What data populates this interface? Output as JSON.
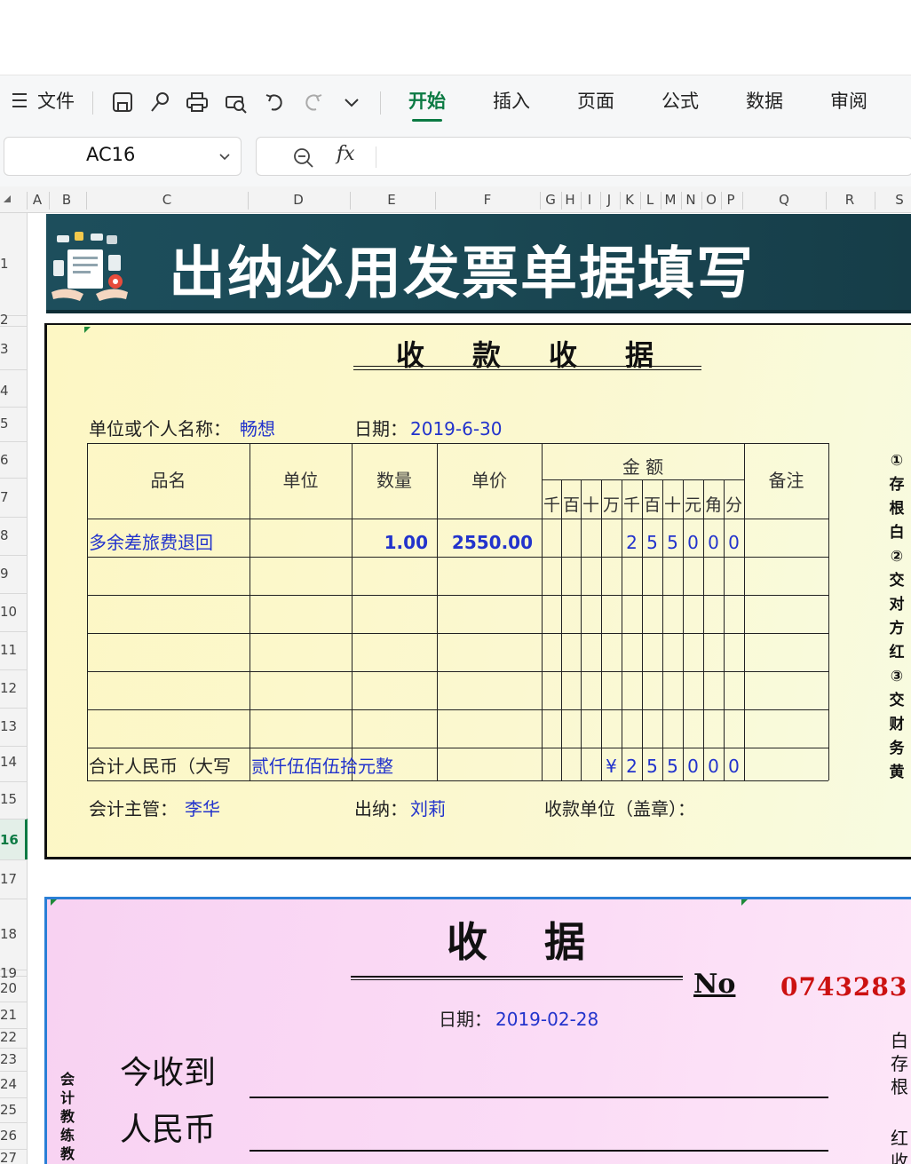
{
  "toolbar": {
    "file_label": "文件",
    "tabs": [
      "开始",
      "插入",
      "页面",
      "公式",
      "数据",
      "审阅"
    ],
    "active_tab": "开始"
  },
  "formula": {
    "cell_ref": "AC16",
    "fx_label": "fx"
  },
  "columns": [
    "A",
    "B",
    "C",
    "D",
    "E",
    "F",
    "G",
    "H",
    "I",
    "J",
    "K",
    "L",
    "M",
    "N",
    "O",
    "P",
    "Q",
    "R",
    "S"
  ],
  "rows": [
    "1",
    "2",
    "3",
    "4",
    "5",
    "6",
    "7",
    "8",
    "9",
    "10",
    "11",
    "12",
    "13",
    "14",
    "15",
    "16",
    "17",
    "18",
    "19",
    "20",
    "21",
    "22",
    "23",
    "24",
    "25",
    "26",
    "27"
  ],
  "selected_row": "16",
  "banner": {
    "title": "出纳必用发票单据填写"
  },
  "receipt1": {
    "title": "收款收据",
    "payer_label": "单位或个人名称：",
    "payer": "畅想",
    "date_label": "日期：",
    "date": "2019-6-30",
    "headers": {
      "name": "品名",
      "unit": "单位",
      "qty": "数量",
      "price": "单价",
      "amount": "金 额",
      "remark": "备注"
    },
    "digit_headers": [
      "千",
      "百",
      "十",
      "万",
      "千",
      "百",
      "十",
      "元",
      "角",
      "分"
    ],
    "item": {
      "name": "多余差旅费退回",
      "qty": "1.00",
      "price": "2550.00",
      "digits": [
        "",
        "",
        "",
        "",
        "2",
        "5",
        "5",
        "0",
        "0",
        "0"
      ]
    },
    "total_label": "合计人民币（大写",
    "total_words": "贰仟伍佰伍拾元整",
    "total_digits": [
      "",
      "",
      "",
      "¥",
      "2",
      "5",
      "5",
      "0",
      "0",
      "0"
    ],
    "accountant_label": "会计主管：",
    "accountant": "李华",
    "cashier_label": "出纳：",
    "cashier": "刘莉",
    "payee_label": "收款单位（盖章）：",
    "copies": [
      "①",
      "存",
      "根",
      "白",
      "②",
      "交",
      "对",
      "方",
      "红",
      "③",
      "交",
      "财",
      "务",
      "黄"
    ]
  },
  "receipt2": {
    "title": "收据",
    "no_label": "No",
    "number": "0743283",
    "date_label": "日期：",
    "date": "2019-02-28",
    "received_label": "今收到",
    "rmb_label": "人民币",
    "left_vertical": [
      "会",
      "计",
      "教",
      "练",
      "教"
    ],
    "right_vertical_1": [
      "白",
      "存",
      "根"
    ],
    "right_vertical_2": [
      "红",
      "收"
    ]
  },
  "colors": {
    "accent": "#0b7a43",
    "banner": "#1d4e5c",
    "receipt1_bg": "#fdf7c4",
    "receipt2_bg": "#f8d2f2",
    "number_red": "#cc1111",
    "value_blue": "#2233cc"
  }
}
